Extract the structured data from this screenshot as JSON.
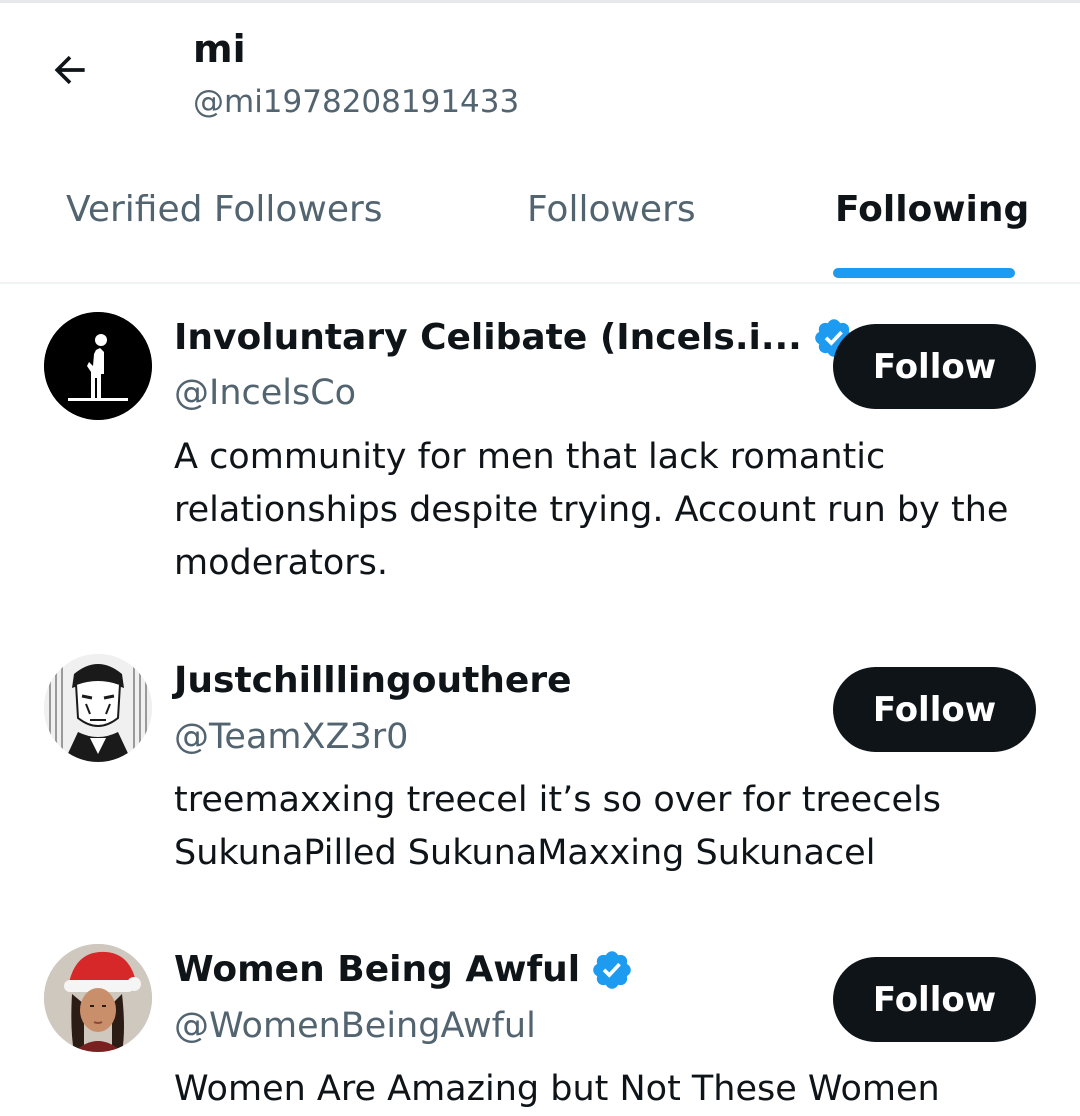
{
  "header": {
    "name": "mi",
    "handle": "@mi1978208191433"
  },
  "tabs": [
    {
      "label": "Verified Followers",
      "active": false
    },
    {
      "label": "Followers",
      "active": false
    },
    {
      "label": "Following",
      "active": true
    }
  ],
  "users": [
    {
      "name": "Involuntary Celibate (Incels.i...",
      "verified": true,
      "handle": "@IncelsCo",
      "bio": "A community for men that lack romantic relationships despite trying. Account run by the moderators.",
      "follow_label": "Follow",
      "avatar_icon": "standing-figure-icon"
    },
    {
      "name": "Justchilllingouthere",
      "verified": false,
      "handle": "@TeamXZ3r0",
      "bio": "treemaxxing treecel it’s so over for treecels SukunaPilled SukunaMaxxing Sukunacel",
      "follow_label": "Follow",
      "avatar_icon": "anime-character-avatar"
    },
    {
      "name": "Women Being Awful",
      "verified": true,
      "handle": "@WomenBeingAwful",
      "bio": "Women Are Amazing but Not These Women",
      "follow_label": "Follow",
      "avatar_icon": "person-santa-hat-avatar"
    }
  ],
  "colors": {
    "accent": "#1d9bf0",
    "text_primary": "#0f1419",
    "text_secondary": "#536471",
    "button_bg": "#0f1419"
  }
}
